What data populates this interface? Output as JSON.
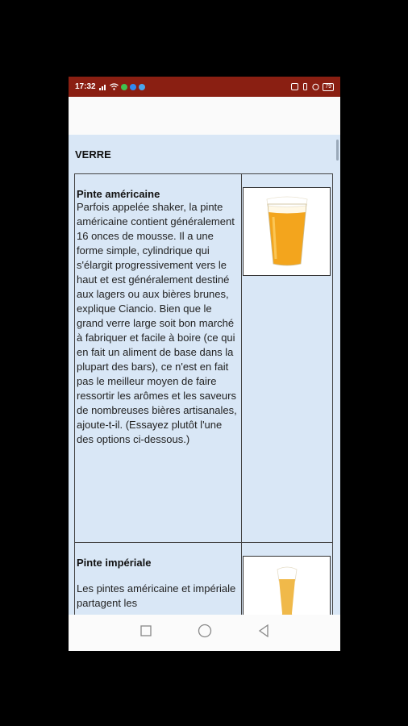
{
  "status_bar": {
    "time": "17:32",
    "battery": "79"
  },
  "content": {
    "section_title": "VERRE",
    "glasses": [
      {
        "name": "Pinte américaine",
        "description": "Parfois appelée shaker, la pinte américaine contient généralement 16 onces de mousse. Il a une forme simple, cylindrique qui s'élargit progressivement vers le haut et est généralement destiné aux lagers ou aux bières brunes, explique Ciancio. Bien que le grand verre large soit bon marché à fabriquer et facile à boire (ce qui en fait un aliment de base dans la plupart des bars), ce n'est en fait pas le meilleur moyen de faire ressortir les arômes et les saveurs de nombreuses bières artisanales, ajoute-t-il. (Essayez plutôt l'une des options ci-dessous.)",
        "image_icon": "pint-glass-icon"
      },
      {
        "name": "Pinte impériale",
        "description": "Les pintes américaine et impériale partagent les",
        "image_icon": "weizen-glass-icon"
      }
    ]
  },
  "colors": {
    "status_bar": "#8a1f12",
    "content_bg": "#d9e7f6",
    "beer": "#f0a21c"
  }
}
